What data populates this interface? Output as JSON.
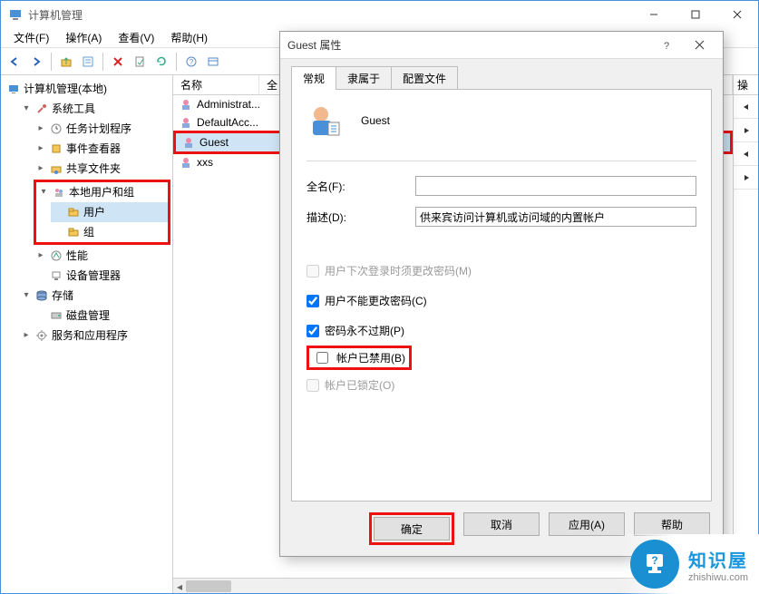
{
  "window": {
    "title": "计算机管理"
  },
  "menu": {
    "file": "文件(F)",
    "action": "操作(A)",
    "view": "查看(V)",
    "help": "帮助(H)"
  },
  "tree": {
    "root": "计算机管理(本地)",
    "system_tools": "系统工具",
    "task_scheduler": "任务计划程序",
    "event_viewer": "事件查看器",
    "shared_folders": "共享文件夹",
    "local_users_groups": "本地用户和组",
    "users": "用户",
    "groups": "组",
    "performance": "性能",
    "device_manager": "设备管理器",
    "storage": "存储",
    "disk_management": "磁盘管理",
    "services_apps": "服务和应用程序"
  },
  "list": {
    "header_name": "名称",
    "header_full": "全",
    "items": [
      {
        "name": "Administrat..."
      },
      {
        "name": "DefaultAcc..."
      },
      {
        "name": "Guest"
      },
      {
        "name": "xxs"
      }
    ]
  },
  "actions_pane": {
    "header": "操"
  },
  "dialog": {
    "title": "Guest 属性",
    "tabs": {
      "general": "常规",
      "member_of": "隶属于",
      "profile": "配置文件"
    },
    "name": "Guest",
    "fullname_label": "全名(F):",
    "fullname_value": "",
    "desc_label": "描述(D):",
    "desc_value": "供来宾访问计算机或访问域的内置帐户",
    "chk_must_change": "用户下次登录时须更改密码(M)",
    "chk_cannot_change": "用户不能更改密码(C)",
    "chk_never_expire": "密码永不过期(P)",
    "chk_disabled": "帐户已禁用(B)",
    "chk_locked": "帐户已锁定(O)",
    "buttons": {
      "ok": "确定",
      "cancel": "取消",
      "apply": "应用(A)",
      "help": "帮助"
    }
  },
  "watermark": {
    "line1": "知识屋",
    "line2": "zhishiwu.com"
  }
}
